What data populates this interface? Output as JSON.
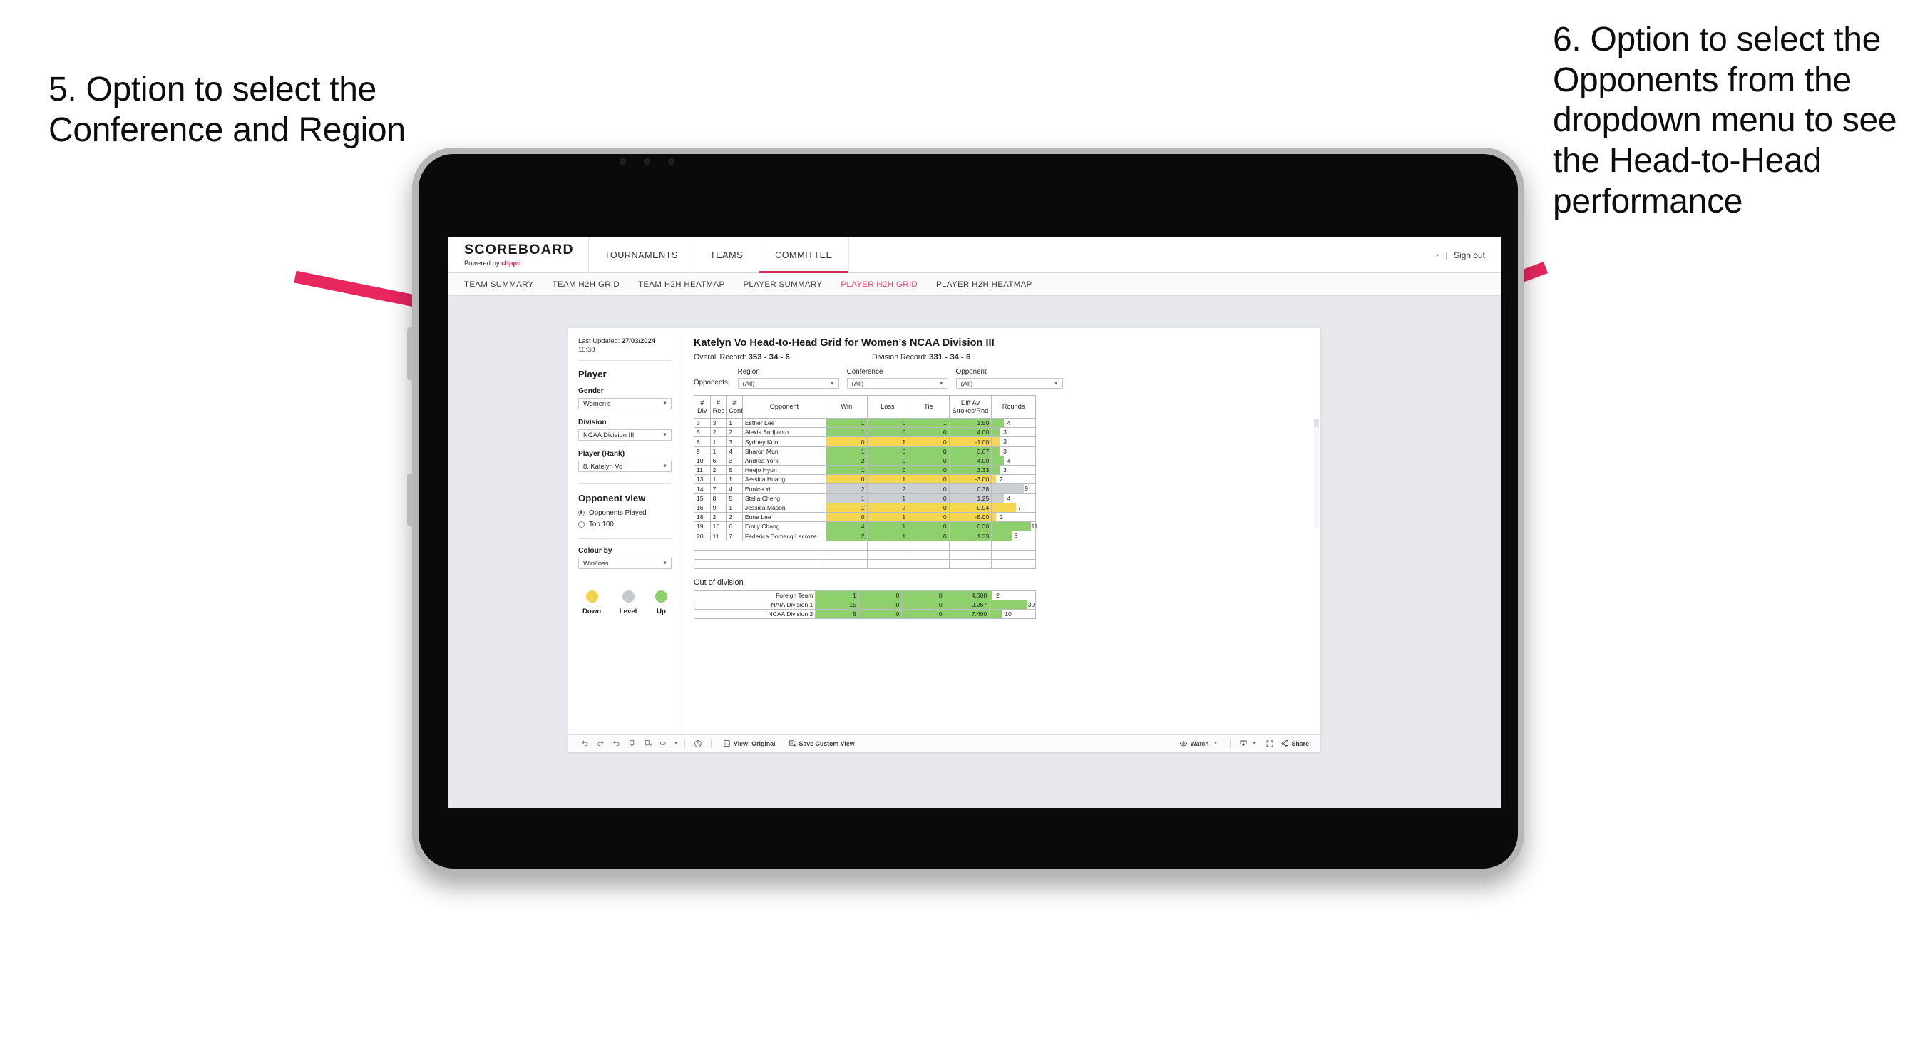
{
  "annotations": {
    "left": "5. Option to select the Conference and Region",
    "right": "6. Option to select the Opponents from the dropdown menu to see the Head-to-Head performance",
    "arrow_color": "#e8275f"
  },
  "app": {
    "brand": {
      "name": "SCOREBOARD",
      "powered_prefix": "Powered by",
      "powered_brand": "clippd"
    },
    "top_nav": [
      {
        "label": "TOURNAMENTS",
        "active": false
      },
      {
        "label": "TEAMS",
        "active": false
      },
      {
        "label": "COMMITTEE",
        "active": true
      }
    ],
    "top_right": {
      "chevron": "›",
      "separator": "|",
      "sign_out": "Sign out"
    },
    "sub_nav": [
      {
        "label": "TEAM SUMMARY",
        "active": false
      },
      {
        "label": "TEAM H2H GRID",
        "active": false
      },
      {
        "label": "TEAM H2H HEATMAP",
        "active": false
      },
      {
        "label": "PLAYER SUMMARY",
        "active": false
      },
      {
        "label": "PLAYER H2H GRID",
        "active": true
      },
      {
        "label": "PLAYER H2H HEATMAP",
        "active": false
      }
    ]
  },
  "sidebar": {
    "last_updated_label": "Last Updated:",
    "last_updated_value": "27/03/2024",
    "last_updated_time": "15:38",
    "player_heading": "Player",
    "gender": {
      "label": "Gender",
      "value": "Women’s"
    },
    "division": {
      "label": "Division",
      "value": "NCAA Division III"
    },
    "player_rank": {
      "label": "Player (Rank)",
      "value": "8. Katelyn Vo"
    },
    "opponent_view": {
      "heading": "Opponent view",
      "options": [
        {
          "label": "Opponents Played",
          "selected": true
        },
        {
          "label": "Top 100",
          "selected": false
        }
      ]
    },
    "colour_by": {
      "label": "Colour by",
      "value": "Win/loss"
    },
    "legend": [
      {
        "label": "Down",
        "color": "#f2d24b"
      },
      {
        "label": "Level",
        "color": "#c6c9cc"
      },
      {
        "label": "Up",
        "color": "#8ed06e"
      }
    ]
  },
  "viz": {
    "title": "Katelyn Vo Head-to-Head Grid for Women’s NCAA Division III",
    "overall_record_label": "Overall Record:",
    "overall_record_value": "353 -  34 - 6",
    "division_record_label": "Division Record:",
    "division_record_value": "331 -  34 - 6",
    "filters": {
      "opponents_label": "Opponents:",
      "region": {
        "label": "Region",
        "value": "(All)"
      },
      "conference": {
        "label": "Conference",
        "value": "(All)"
      },
      "opponent": {
        "label": "Opponent",
        "value": "(All)"
      }
    },
    "out_of_division_title": "Out of division"
  },
  "chart_data": {
    "type": "table",
    "title": "Katelyn Vo Head-to-Head Grid for Women’s NCAA Division III",
    "columns": [
      "# Div",
      "# Reg",
      "# Conf",
      "Opponent",
      "Win",
      "Loss",
      "Tie",
      "Diff Av Strokes/Rnd",
      "Rounds"
    ],
    "column_headers_two_line": [
      {
        "top": "#",
        "bottom": "Div"
      },
      {
        "top": "#",
        "bottom": "Reg"
      },
      {
        "top": "#",
        "bottom": "Conf"
      },
      {
        "top": "",
        "bottom": "Opponent"
      },
      {
        "top": "Win",
        "bottom": ""
      },
      {
        "top": "Loss",
        "bottom": ""
      },
      {
        "top": "Tie",
        "bottom": ""
      },
      {
        "top": "Diff Av",
        "bottom": "Strokes/Rnd"
      },
      {
        "top": "Rounds",
        "bottom": ""
      }
    ],
    "rows": [
      {
        "div": "3",
        "reg": "3",
        "conf": "1",
        "opponent": "Esther Lee",
        "win": "1",
        "loss": "0",
        "tie": "1",
        "diff": "1.50",
        "rounds": "4",
        "rounds_pct": 28,
        "state": "up"
      },
      {
        "div": "5",
        "reg": "2",
        "conf": "2",
        "opponent": "Alexis Sudjianto",
        "win": "1",
        "loss": "0",
        "tie": "0",
        "diff": "4.00",
        "rounds": "3",
        "rounds_pct": 18,
        "state": "up"
      },
      {
        "div": "6",
        "reg": "1",
        "conf": "3",
        "opponent": "Sydney Kuo",
        "win": "0",
        "loss": "1",
        "tie": "0",
        "diff": "-1.00",
        "rounds": "3",
        "rounds_pct": 18,
        "state": "down"
      },
      {
        "div": "9",
        "reg": "1",
        "conf": "4",
        "opponent": "Sharon Mun",
        "win": "1",
        "loss": "0",
        "tie": "0",
        "diff": "3.67",
        "rounds": "3",
        "rounds_pct": 18,
        "state": "up"
      },
      {
        "div": "10",
        "reg": "6",
        "conf": "3",
        "opponent": "Andrea York",
        "win": "2",
        "loss": "0",
        "tie": "0",
        "diff": "4.00",
        "rounds": "4",
        "rounds_pct": 28,
        "state": "up"
      },
      {
        "div": "11",
        "reg": "2",
        "conf": "5",
        "opponent": "Heejo Hyun",
        "win": "1",
        "loss": "0",
        "tie": "0",
        "diff": "3.33",
        "rounds": "3",
        "rounds_pct": 18,
        "state": "up"
      },
      {
        "div": "13",
        "reg": "1",
        "conf": "1",
        "opponent": "Jessica Huang",
        "win": "0",
        "loss": "1",
        "tie": "0",
        "diff": "-3.00",
        "rounds": "2",
        "rounds_pct": 9,
        "state": "down"
      },
      {
        "div": "14",
        "reg": "7",
        "conf": "4",
        "opponent": "Eunice Yi",
        "win": "2",
        "loss": "2",
        "tie": "0",
        "diff": "0.38",
        "rounds": "9",
        "rounds_pct": 73,
        "state": "level"
      },
      {
        "div": "15",
        "reg": "8",
        "conf": "5",
        "opponent": "Stella Cheng",
        "win": "1",
        "loss": "1",
        "tie": "0",
        "diff": "1.25",
        "rounds": "4",
        "rounds_pct": 28,
        "state": "level"
      },
      {
        "div": "16",
        "reg": "9",
        "conf": "1",
        "opponent": "Jessica Mason",
        "win": "1",
        "loss": "2",
        "tie": "0",
        "diff": "-0.94",
        "rounds": "7",
        "rounds_pct": 55,
        "state": "down"
      },
      {
        "div": "18",
        "reg": "2",
        "conf": "2",
        "opponent": "Euna Lee",
        "win": "0",
        "loss": "1",
        "tie": "0",
        "diff": "-5.00",
        "rounds": "2",
        "rounds_pct": 9,
        "state": "down"
      },
      {
        "div": "19",
        "reg": "10",
        "conf": "6",
        "opponent": "Emily Chang",
        "win": "4",
        "loss": "1",
        "tie": "0",
        "diff": "0.30",
        "rounds": "11",
        "rounds_pct": 90,
        "state": "up"
      },
      {
        "div": "20",
        "reg": "11",
        "conf": "7",
        "opponent": "Federica Domecq Lacroze",
        "win": "2",
        "loss": "1",
        "tie": "0",
        "diff": "1.33",
        "rounds": "6",
        "rounds_pct": 46,
        "state": "up"
      }
    ],
    "out_of_division": {
      "title": "Out of division",
      "rows": [
        {
          "name": "Foreign Team",
          "win": "1",
          "loss": "0",
          "tie": "0",
          "diff": "4.500",
          "rounds": "2",
          "rounds_pct": 5,
          "state": "up"
        },
        {
          "name": "NAIA Division 1",
          "win": "15",
          "loss": "0",
          "tie": "0",
          "diff": "9.267",
          "rounds": "30",
          "rounds_pct": 82,
          "state": "up"
        },
        {
          "name": "NCAA Division 2",
          "win": "5",
          "loss": "0",
          "tie": "0",
          "diff": "7.400",
          "rounds": "10",
          "rounds_pct": 26,
          "state": "up"
        }
      ]
    },
    "colors": {
      "up": "#8ed06e",
      "down": "#f5d64e",
      "level": "#cccfd2"
    }
  },
  "toolbar": {
    "icons": [
      {
        "name": "undo-icon",
        "glyph": "↶"
      },
      {
        "name": "redo-icon",
        "glyph": "↷"
      },
      {
        "name": "revert-icon",
        "glyph": "↺"
      },
      {
        "name": "refresh-data-icon",
        "glyph": "⥁"
      },
      {
        "name": "pause-auto-update-icon",
        "glyph": "⏸"
      },
      {
        "name": "highlight-icon",
        "glyph": "⬭"
      }
    ],
    "dashboard_icon": "◔",
    "view_label": "View: Original",
    "save_custom_view_label": "Save Custom View",
    "watch_label": "Watch",
    "share_label": "Share",
    "download_icon": "download-icon",
    "fullscreen_icon": "fullscreen-icon"
  }
}
